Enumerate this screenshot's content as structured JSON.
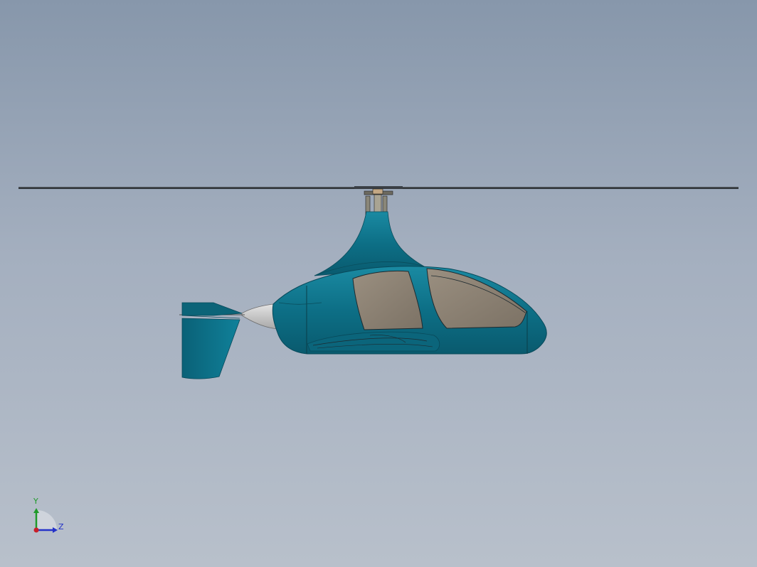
{
  "viewport": {
    "background_top": "#8797ab",
    "background_bottom": "#b8c0cb"
  },
  "model": {
    "subject": "gyrocopter",
    "body_color": "#0d6f86",
    "canopy_color": "#877c6e",
    "spinner_color": "#c9c9c9",
    "rotor_color": "#2a2e33"
  },
  "triad": {
    "y_label": "Y",
    "z_label": "Z",
    "y_color": "#1f9a2a",
    "z_color": "#2432c8",
    "x_color": "#c81f2a"
  }
}
